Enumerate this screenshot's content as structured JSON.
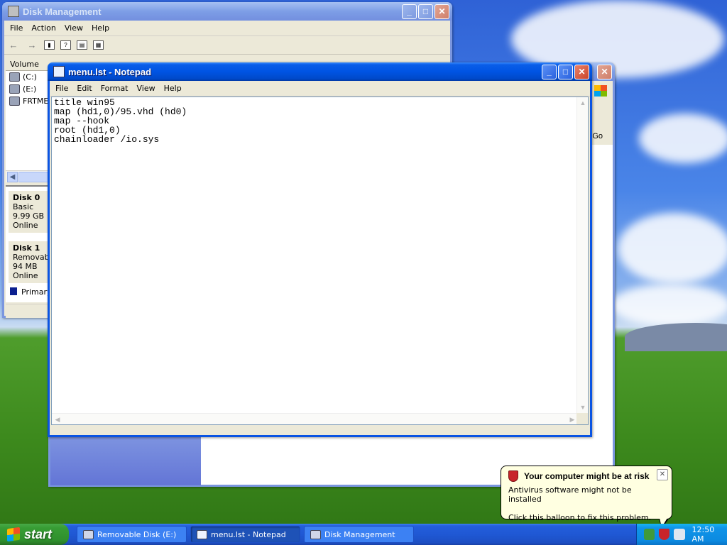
{
  "desktop": {},
  "disk_management": {
    "title": "Disk Management",
    "menu": [
      "File",
      "Action",
      "View",
      "Help"
    ],
    "columns": {
      "volume": "Volume"
    },
    "volumes": [
      "(C:)",
      "(E:)",
      "FRTMEV"
    ],
    "disks": [
      {
        "name": "Disk 0",
        "type": "Basic",
        "size": "9.99 GB",
        "status": "Online"
      },
      {
        "name": "Disk 1",
        "type": "Removable",
        "size": "94 MB",
        "status": "Online"
      }
    ],
    "legend": "Primary p"
  },
  "background_window": {
    "go_label": "Go"
  },
  "notepad": {
    "title": "menu.lst - Notepad",
    "menu": [
      "File",
      "Edit",
      "Format",
      "View",
      "Help"
    ],
    "content": "title win95\nmap (hd1,0)/95.vhd (hd0)\nmap --hook\nroot (hd1,0)\nchainloader /io.sys"
  },
  "taskbar": {
    "start_label": "start",
    "tasks": [
      {
        "label": "Removable Disk (E:)",
        "icon": "drive-icon"
      },
      {
        "label": "menu.lst - Notepad",
        "icon": "notepad-icon"
      },
      {
        "label": "Disk Management",
        "icon": "disk-management-icon"
      }
    ],
    "clock": "12:50 AM"
  },
  "balloon": {
    "title": "Your computer might be at risk",
    "line1": "Antivirus software might not be installed",
    "line2": "Click this balloon to fix this problem."
  }
}
